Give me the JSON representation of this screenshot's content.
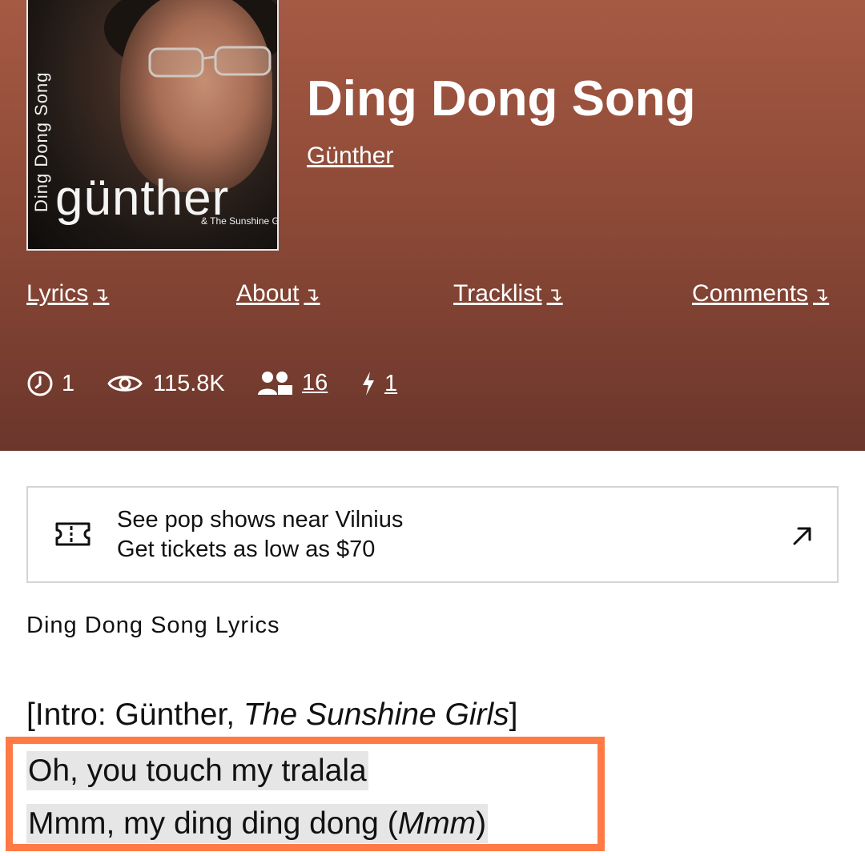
{
  "song": {
    "title": "Ding Dong Song",
    "artist": "Günther"
  },
  "cover": {
    "vertical_text": "Ding Dong Song",
    "logo_text": "günther",
    "sub_text": "& The Sunshine Girls"
  },
  "nav": [
    {
      "label": "Lyrics",
      "arrow": "↴"
    },
    {
      "label": "About",
      "arrow": "↴"
    },
    {
      "label": "Tracklist",
      "arrow": "↴"
    },
    {
      "label": "Comments",
      "arrow": "↴"
    }
  ],
  "stats": {
    "contributors": "1",
    "views": "115.8K",
    "followers": "16",
    "annotations": "1"
  },
  "ticket": {
    "line1": "See pop shows near Vilnius",
    "line2": "Get tickets as low as $70"
  },
  "lyrics": {
    "heading": "Ding Dong Song Lyrics",
    "intro_prefix": "[Intro: Günther, ",
    "intro_italic": "The Sunshine Girls",
    "intro_suffix": "]",
    "line1": "Oh, you touch my tralala",
    "line2_prefix": "Mmm, my ding ding dong (",
    "line2_italic": "Mmm",
    "line2_suffix": ")"
  },
  "colors": {
    "header_top": "#a55a44",
    "header_bottom": "#6b362c",
    "highlight_border": "#ff7a45",
    "highlight_bg": "#e6e6e6"
  }
}
